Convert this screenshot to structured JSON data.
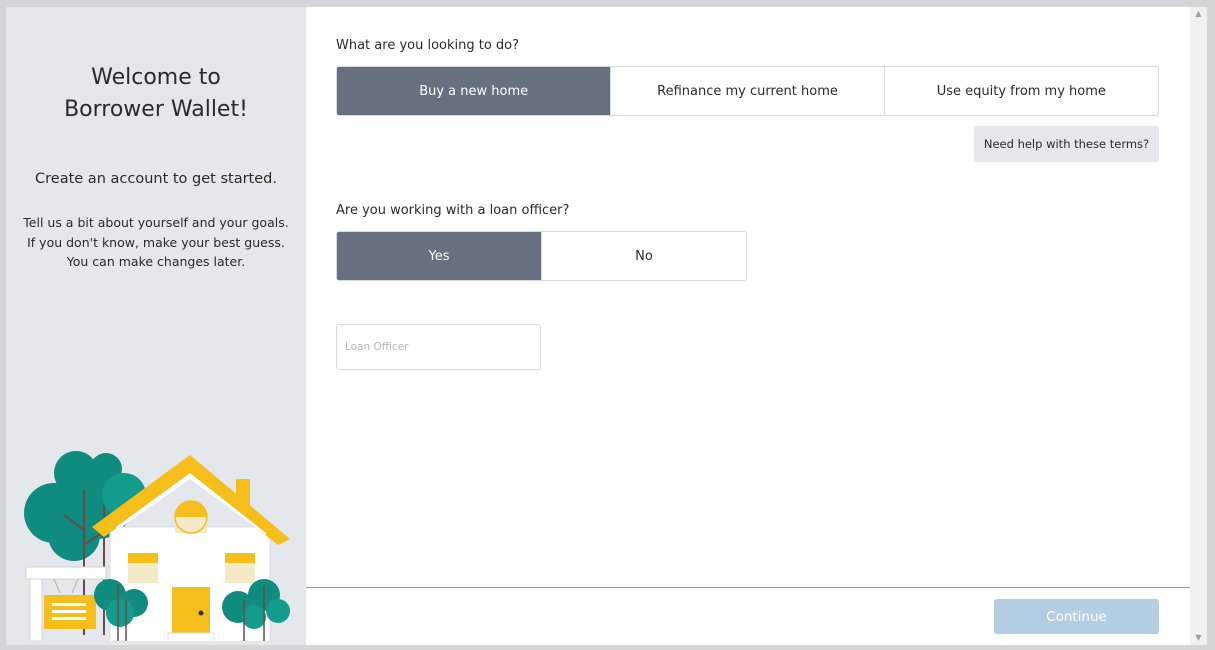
{
  "sidebar": {
    "welcome_line1": "Welcome to",
    "welcome_line2": "Borrower Wallet!",
    "create": "Create an account to get started.",
    "tell_line1": "Tell us a bit about yourself and your goals.",
    "tell_line2": "If you don't know, make your best guess.",
    "tell_line3": "You can make changes later."
  },
  "goal": {
    "question": "What are you looking to do?",
    "options": [
      "Buy a new home",
      "Refinance my current home",
      "Use equity from my home"
    ],
    "selected": "Buy a new home",
    "help_label": "Need help with these terms?"
  },
  "loan_officer": {
    "question": "Are you working with a loan officer?",
    "options": [
      "Yes",
      "No"
    ],
    "selected": "Yes",
    "input_placeholder": "Loan Officer",
    "input_value": ""
  },
  "footer": {
    "continue_label": "Continue"
  },
  "colors": {
    "sidebar_bg": "#e4e7eb",
    "selected_option": "#67707f",
    "continue_disabled": "#b3cde3",
    "house_yellow": "#f6be1a",
    "tree_teal": "#0f8c7d"
  },
  "icons": {
    "illustration": "house-illustration",
    "scroll_up": "scroll-up-arrow",
    "scroll_down": "scroll-down-arrow"
  }
}
